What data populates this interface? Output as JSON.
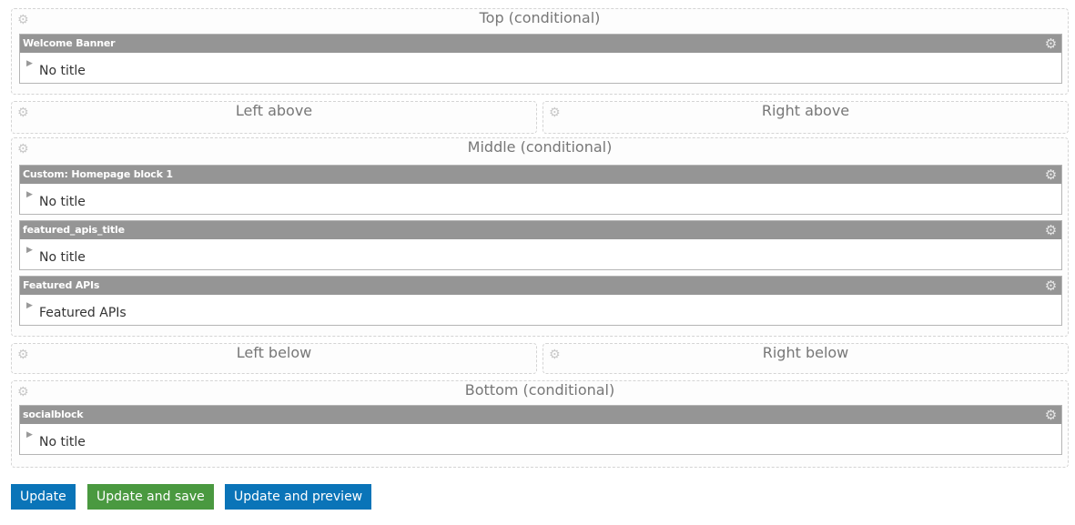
{
  "regions": {
    "top": {
      "title": "Top (conditional)",
      "panes": [
        {
          "header": "Welcome Banner",
          "body": "No title"
        }
      ]
    },
    "left_above": {
      "title": "Left above"
    },
    "right_above": {
      "title": "Right above"
    },
    "middle": {
      "title": "Middle (conditional)",
      "panes": [
        {
          "header": "Custom: Homepage block 1",
          "body": "No title"
        },
        {
          "header": "featured_apis_title",
          "body": "No title"
        },
        {
          "header": "Featured APIs",
          "body": "Featured APIs"
        }
      ]
    },
    "left_below": {
      "title": "Left below"
    },
    "right_below": {
      "title": "Right below"
    },
    "bottom": {
      "title": "Bottom (conditional)",
      "panes": [
        {
          "header": "socialblock",
          "body": "No title"
        }
      ]
    }
  },
  "icons": {
    "region_settings": "gear-icon",
    "pane_settings": "gear-icon",
    "pane_toggle": "triangle-right-icon"
  },
  "buttons": {
    "update": "Update",
    "update_and_save": "Update and save",
    "update_and_preview": "Update and preview"
  },
  "colors": {
    "pane_header": "#959595",
    "button_blue": "#0a74b8",
    "button_green": "#4a9940"
  }
}
